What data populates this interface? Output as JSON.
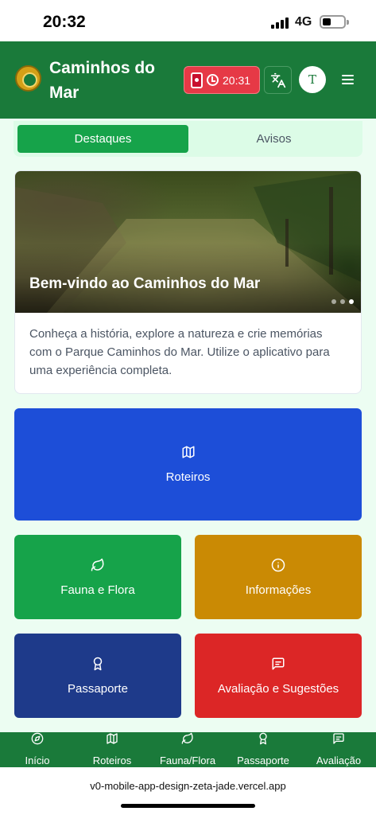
{
  "status_bar": {
    "time": "20:32",
    "network": "4G"
  },
  "header": {
    "title": "Caminhos do Mar",
    "timer": "20:31",
    "avatar_initial": "T"
  },
  "tabs": [
    {
      "label": "Destaques",
      "active": true
    },
    {
      "label": "Avisos",
      "active": false
    }
  ],
  "hero": {
    "title": "Bem-vindo ao Caminhos do Mar",
    "description": "Conheça a história, explore a natureza e crie memórias com o Parque Caminhos do Mar. Utilize o aplicativo para uma experiência completa.",
    "slides": 3,
    "active_slide": 3
  },
  "tiles": {
    "roteiros": {
      "label": "Roteiros",
      "icon": "map-icon",
      "color": "#1d4ed8"
    },
    "fauna": {
      "label": "Fauna e Flora",
      "icon": "leaf-icon",
      "color": "#16a34a"
    },
    "info": {
      "label": "Informações",
      "icon": "info-icon",
      "color": "#ca8a04"
    },
    "passaporte": {
      "label": "Passaporte",
      "icon": "award-icon",
      "color": "#1e3a8a"
    },
    "avaliacao": {
      "label": "Avaliação e Sugestões",
      "icon": "message-square-icon",
      "color": "#dc2626"
    }
  },
  "bottom_nav": [
    {
      "label": "Início",
      "icon": "compass-icon"
    },
    {
      "label": "Roteiros",
      "icon": "map-icon"
    },
    {
      "label": "Fauna/Flora",
      "icon": "leaf-icon"
    },
    {
      "label": "Passaporte",
      "icon": "award-icon"
    },
    {
      "label": "Avaliação",
      "icon": "message-square-icon"
    }
  ],
  "browser": {
    "url": "v0-mobile-app-design-zeta-jade.vercel.app"
  },
  "colors": {
    "header": "#1a7a3a",
    "background": "#ecfdf2",
    "timer": "#e63946"
  }
}
